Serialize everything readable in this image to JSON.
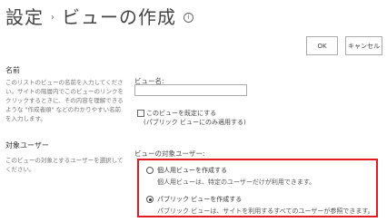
{
  "breadcrumb": {
    "root": "設定",
    "separator": "›",
    "current": "ビューの作成",
    "info_icon": "info-icon"
  },
  "toolbar": {
    "ok_label": "OK",
    "cancel_label": "キャンセル"
  },
  "name_section": {
    "title": "名前",
    "description": "このリストのビューの名前を入力してください。サイトの階層内でこのビューのリンクをクリックするときに、その内容を理解できるような \"作成者順\" などのわかりやすい名前を入力します。",
    "field_label": "ビュー名:",
    "view_name_value": "",
    "default_view_label_1": "このビューを既定にする",
    "default_view_label_2": "(パブリック ビューにのみ適用する)",
    "default_view_checked": false
  },
  "audience_section": {
    "title": "対象ユーザー",
    "description": "このビューの対象とするユーザーを選択してください。",
    "field_label": "ビューの対象ユーザー:",
    "options": [
      {
        "label": "個人用ビューを作成する",
        "description": "個人用ビューは、特定のユーザーだけが利用できます。",
        "selected": false
      },
      {
        "label": "パブリック ビューを作成する",
        "description": "パブリック ビューは、サイトを利用するすべてのユーザーが参照できます。",
        "selected": true
      }
    ]
  },
  "colors": {
    "highlight_border": "#e21b23"
  }
}
